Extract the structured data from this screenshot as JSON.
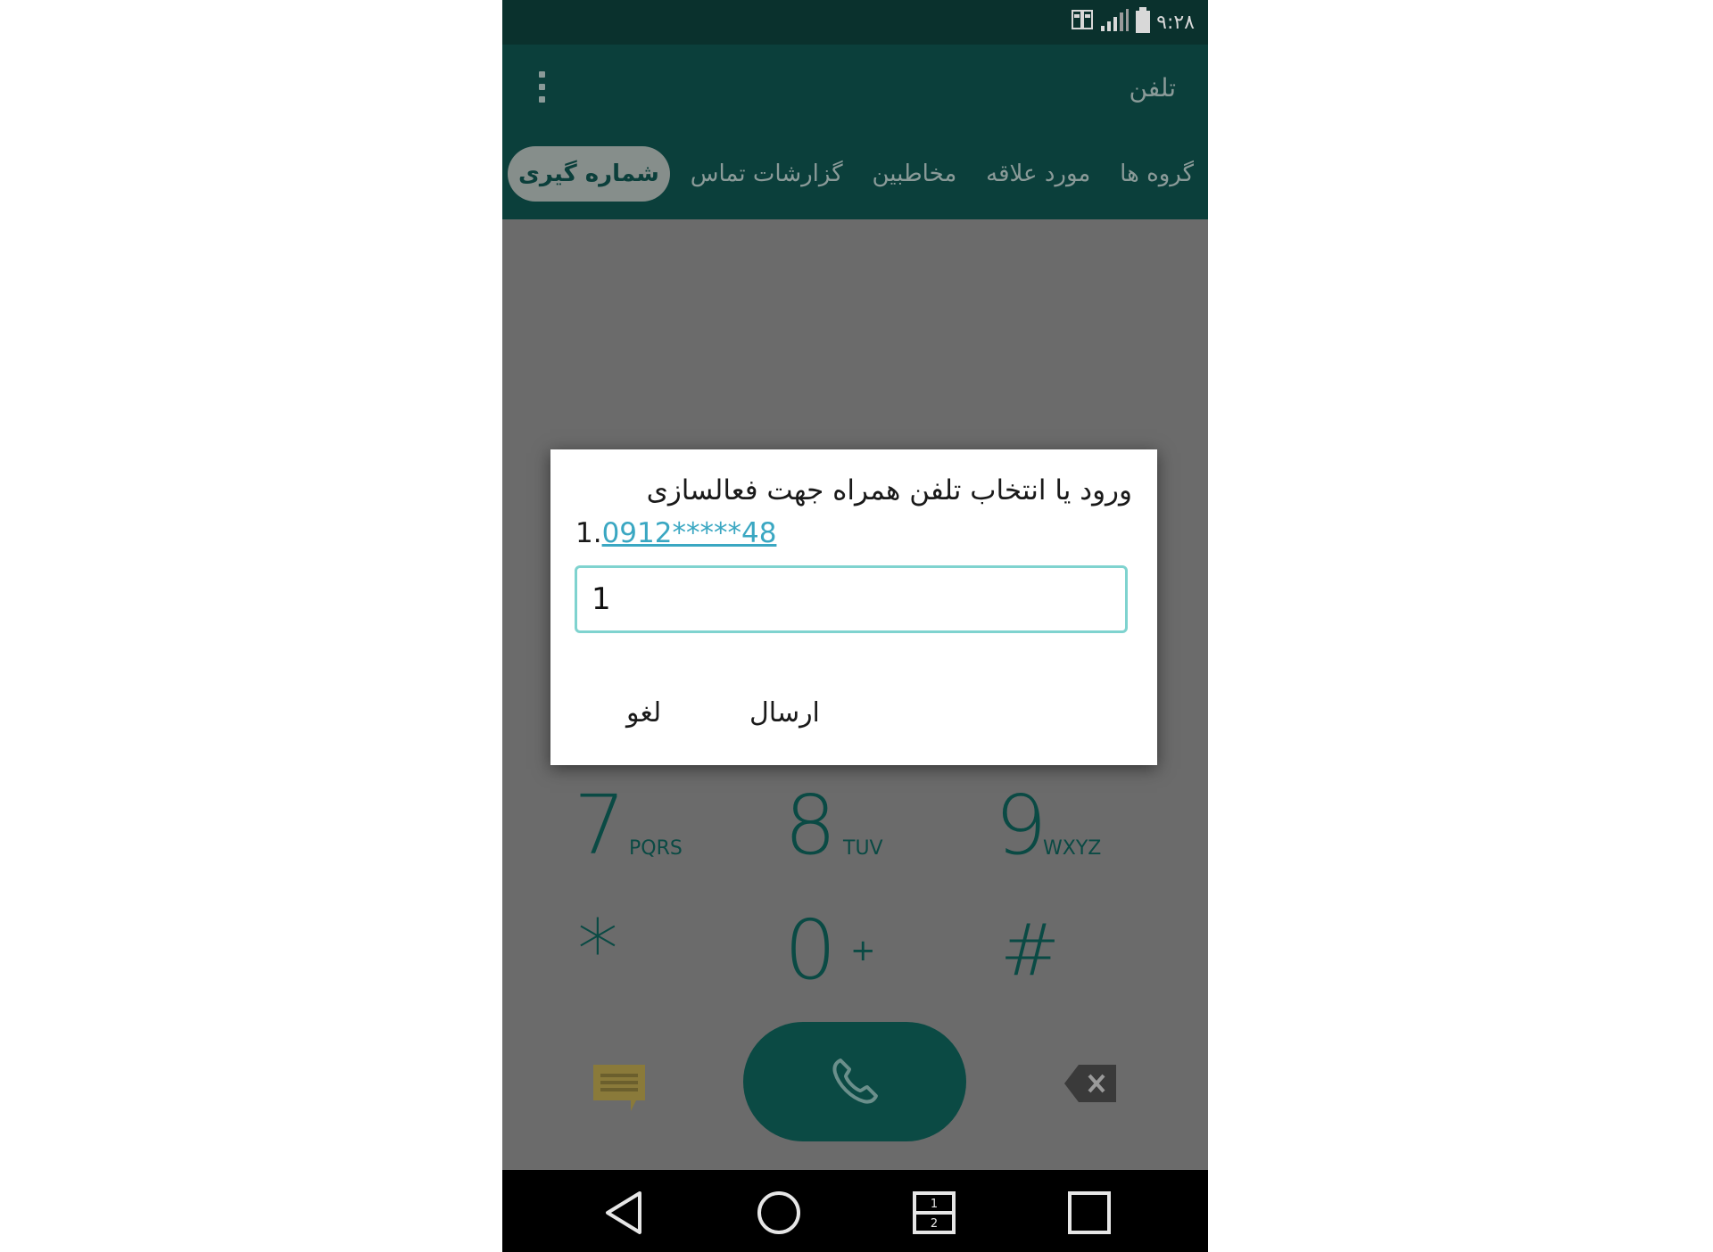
{
  "status_bar": {
    "time": "۹:۲۸"
  },
  "toolbar": {
    "title": "تلفن",
    "tabs": [
      "گروه ها",
      "مورد علاقه",
      "مخاطبین",
      "گزارشات تماس",
      "شماره گیری"
    ],
    "active_tab_index": 4
  },
  "dialpad": {
    "keys": [
      {
        "digit": "7",
        "letters": "PQRS"
      },
      {
        "digit": "8",
        "letters": "TUV"
      },
      {
        "digit": "9",
        "letters": "WXYZ"
      },
      {
        "digit": "*",
        "letters": ""
      },
      {
        "digit": "0",
        "letters": "+"
      },
      {
        "digit": "#",
        "letters": ""
      }
    ]
  },
  "dialog": {
    "title": "ورود یا انتخاب تلفن همراه جهت فعالسازی",
    "option_index": "1.",
    "option_number": "0912*****48",
    "input_value": "1",
    "send_label": "ارسال",
    "cancel_label": "لغو"
  },
  "colors": {
    "toolbar": "#0b3f3b",
    "status_bar": "#0a312d",
    "accent": "#0b4a44",
    "link": "#3aa7c2",
    "input_border": "#7fd3cf",
    "message_icon": "#8a7a3a"
  },
  "icons": {
    "status": [
      "sim-icon",
      "signal-icon",
      "battery-icon"
    ],
    "toolbar": [
      "overflow-menu-icon"
    ],
    "dialer": [
      "message-icon",
      "phone-icon",
      "backspace-icon"
    ],
    "nav": [
      "back-icon",
      "home-icon",
      "dual-window-icon",
      "recents-icon"
    ]
  }
}
